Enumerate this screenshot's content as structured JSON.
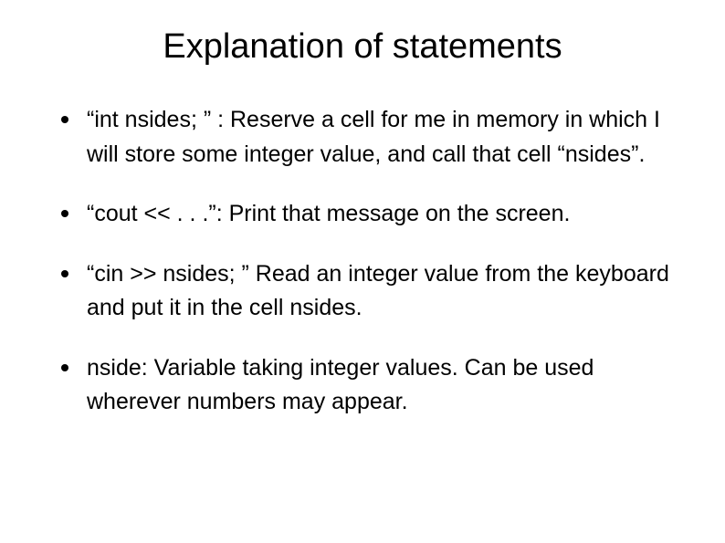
{
  "title": "Explanation of statements",
  "bullets": [
    "“int nsides; ” : Reserve a cell for me in memory in which I will store some integer value, and call that cell “nsides”.",
    "“cout << . . .”: Print that message on the screen.",
    "“cin >> nsides; ”  Read an integer value from the keyboard and put it in the cell nsides.",
    "nside:  Variable taking integer values.  Can be used wherever numbers may appear."
  ]
}
